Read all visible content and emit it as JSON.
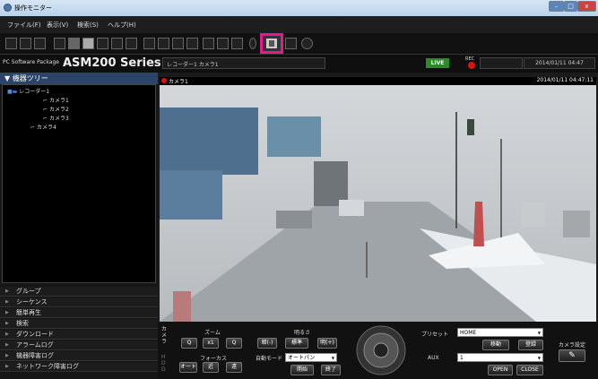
{
  "window": {
    "title": "操作モニター",
    "min": "–",
    "max": "□",
    "close": "x"
  },
  "menu": {
    "items": [
      "ファイル(F)",
      "表示(V)",
      "検索(S)",
      "ヘルプ(H)"
    ]
  },
  "brand": {
    "prefix": "PC Software Package",
    "series": "ASM200 Series"
  },
  "status": {
    "camera_header": "レコーダー1 カメラ1",
    "live": "LIVE",
    "rec": "REC",
    "datetime": "2014/01/11 04:47"
  },
  "sidebar": {
    "tree_header": "機器ツリー",
    "tree": [
      {
        "label": "レコーダー1"
      },
      {
        "label": "カメラ1"
      },
      {
        "label": "カメラ2"
      },
      {
        "label": "カメラ3"
      },
      {
        "label": "カメラ4"
      }
    ],
    "nav": [
      "グループ",
      "シーケンス",
      "簡単再生",
      "検索",
      "ダウンロード",
      "アラームログ",
      "機器障害ログ",
      "ネットワーク障害ログ"
    ]
  },
  "video": {
    "camera_label": "カメラ1",
    "timestamp": "2014/01/11 04:47:11"
  },
  "controls": {
    "camera_tab": "カメラ",
    "hddtab": "HDD",
    "zoom_label": "ズーム",
    "zoom_out": "Q",
    "zoom_x1": "x1",
    "zoom_in": "Q",
    "focus_label": "フォーカス",
    "focus_auto": "オート",
    "focus_near": "近",
    "focus_far": "遠",
    "brightness_label": "明るさ",
    "bright_dark": "暗(-)",
    "bright_std": "標準",
    "bright_light": "明(+)",
    "auto_mode_label": "自動モード",
    "auto_mode_value": "オートパン",
    "start": "開始",
    "end": "終了",
    "preset_label": "プリセット",
    "preset_value": "HOME",
    "move": "移動",
    "register": "登録",
    "aux_label": "AUX",
    "aux_value": "1",
    "open": "OPEN",
    "close": "CLOSE",
    "camera_settings": "カメラ設定"
  }
}
